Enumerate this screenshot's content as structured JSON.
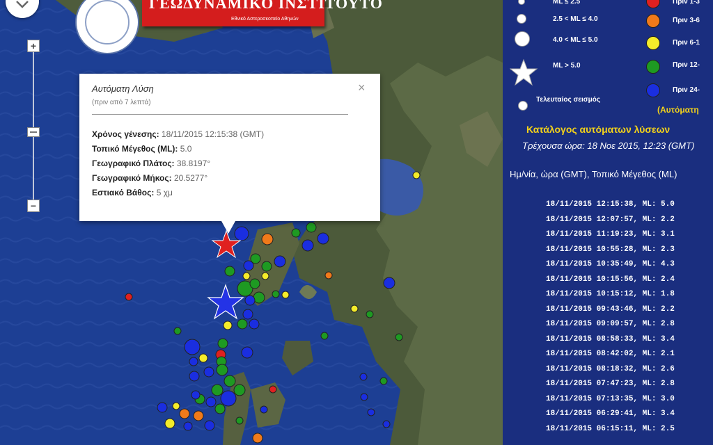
{
  "logo": {
    "title": "ΓΕΩΔΥΝΑΜΙΚΟ ΙΝΣΤΙΤΟΥΤΟ",
    "subtitle": "Εθνικό Αστεροσκοπείο Αθηνών"
  },
  "zoom": {
    "in_label": "+",
    "out_label": "−"
  },
  "popup": {
    "title": "Αυτόματη Λύση",
    "subtitle": "(πριν από 7 λεπτά)",
    "close": "×",
    "rows": [
      {
        "label": "Χρόνος γένεσης:",
        "value": "18/11/2015 12:15:38 (GMT)"
      },
      {
        "label": "Τοπικό Μέγεθος (ML):",
        "value": "5.0"
      },
      {
        "label": "Γεωγραφικό Πλάτος:",
        "value": "38.8197°"
      },
      {
        "label": "Γεωγραφικό Μήκος:",
        "value": "20.5277°"
      },
      {
        "label": "Εστιακό Βάθος:",
        "value": "5 χμ"
      }
    ]
  },
  "legend": {
    "magnitude": [
      {
        "label": "ML ≤ 2.5",
        "size": "tiny"
      },
      {
        "label": "2.5 < ML ≤ 4.0",
        "size": "small"
      },
      {
        "label": "4.0 < ML ≤ 5.0",
        "size": "medium"
      },
      {
        "label": "ML > 5.0",
        "size": "star"
      },
      {
        "label": "Τελευταίος σεισμός",
        "size": "last"
      }
    ],
    "age": [
      {
        "label": "Πριν 1-3",
        "color": "#e02020"
      },
      {
        "label": "Πριν 3-6",
        "color": "#f07a1a"
      },
      {
        "label": "Πριν 6-1",
        "color": "#f4ec2a"
      },
      {
        "label": "Πριν 12-",
        "color": "#1e9a22"
      },
      {
        "label": "Πριν 24-",
        "color": "#1a2ee0"
      }
    ],
    "note": "(Αυτόματη"
  },
  "catalog": {
    "title": "Κατάλογος αυτόματων λύσεων",
    "current_time": "Τρέχουσα ώρα: 18 Νοε 2015, 12:23 (GMT)",
    "columns": "Ημ/νία, ώρα (GMT), Τοπικό Μέγεθος (ML)",
    "entries": [
      "18/11/2015 12:15:38,  ML: 5.0",
      "18/11/2015 12:07:57,  ML: 2.2",
      "18/11/2015 11:19:23,  ML: 3.1",
      "18/11/2015 10:55:28,  ML: 2.3",
      "18/11/2015 10:35:49,  ML: 4.3",
      "18/11/2015 10:15:56,  ML: 2.4",
      "18/11/2015 10:15:12,  ML: 1.8",
      "18/11/2015 09:43:46,  ML: 2.2",
      "18/11/2015 09:09:57,  ML: 2.8",
      "18/11/2015 08:58:33,  ML: 3.4",
      "18/11/2015 08:42:02,  ML: 2.1",
      "18/11/2015 08:18:32,  ML: 2.6",
      "18/11/2015 07:47:23,  ML: 2.8",
      "18/11/2015 07:13:35,  ML: 3.0",
      "18/11/2015 06:29:41,  ML: 3.4",
      "18/11/2015 06:15:11,  ML: 2.5"
    ]
  }
}
